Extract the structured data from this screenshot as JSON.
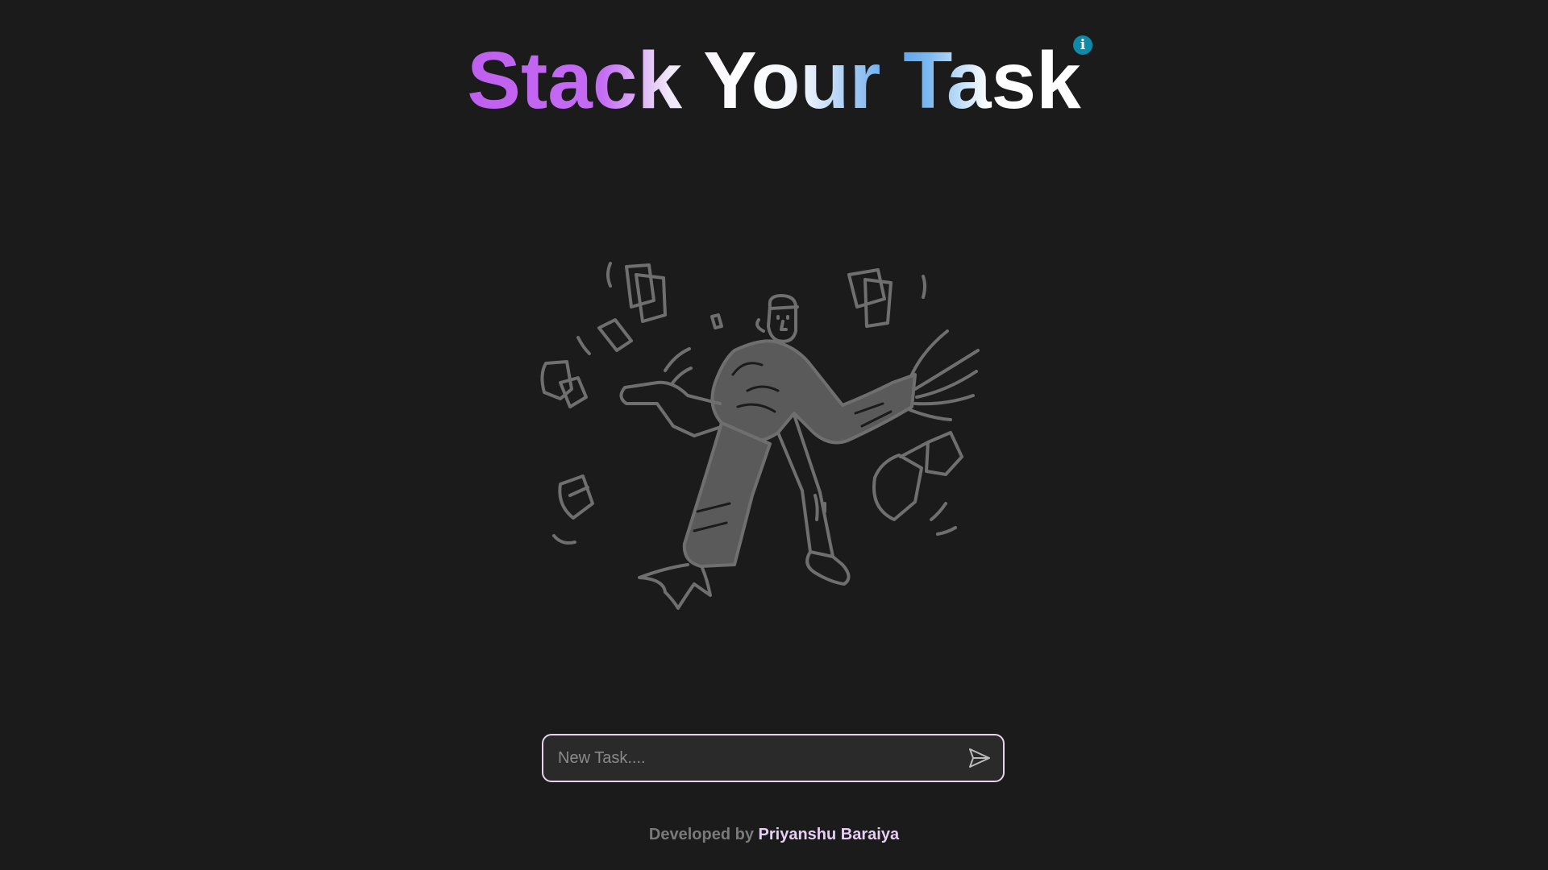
{
  "header": {
    "title": "Stack Your Task",
    "info_icon": "info-icon",
    "title_gradient": [
      "#c05ff0",
      "#ffffff",
      "#5aa3ec"
    ],
    "info_color": "#0c8aa6"
  },
  "illustration": {
    "icon": "man-juggling-papers-illustration"
  },
  "task_form": {
    "placeholder": "New Task....",
    "value": "",
    "send_icon": "send-icon",
    "border_color": "#e9d2ef"
  },
  "footer": {
    "prefix": "Developed by",
    "author": "Priyanshu Baraiya"
  },
  "colors": {
    "background": "#1b1b1b",
    "illustration_stroke": "#6f6f6f",
    "illustration_fill": "#5a5a5a"
  }
}
